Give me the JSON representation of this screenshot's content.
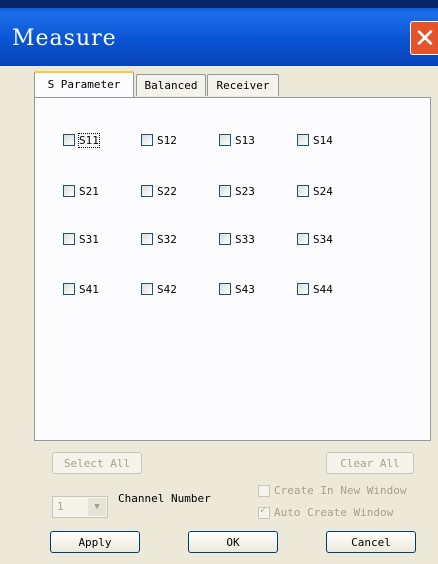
{
  "window": {
    "title": "Measure"
  },
  "tabs": [
    {
      "label": "S Parameter",
      "active": true
    },
    {
      "label": "Balanced",
      "active": false
    },
    {
      "label": "Receiver",
      "active": false
    }
  ],
  "params": [
    [
      "S11",
      "S12",
      "S13",
      "S14"
    ],
    [
      "S21",
      "S22",
      "S23",
      "S24"
    ],
    [
      "S31",
      "S32",
      "S33",
      "S34"
    ],
    [
      "S41",
      "S42",
      "S43",
      "S44"
    ]
  ],
  "buttons": {
    "select_all": "Select All",
    "clear_all": "Clear All",
    "apply": "Apply",
    "ok": "OK",
    "cancel": "Cancel"
  },
  "channel": {
    "value": "1",
    "label": "Channel Number"
  },
  "options": {
    "create_new_window": {
      "label": "Create In New Window",
      "checked": false
    },
    "auto_create_window": {
      "label": "Auto Create Window",
      "checked": true
    }
  }
}
